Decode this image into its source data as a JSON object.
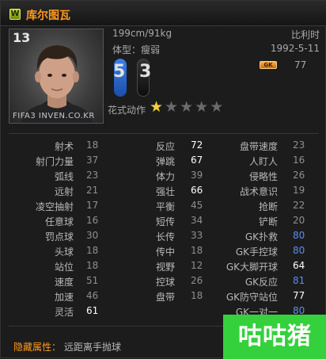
{
  "header": {
    "badge": "W",
    "name": "库尔图瓦"
  },
  "portrait": {
    "rating": "13",
    "watermark": "FIFA3 INVEN.CO.KR"
  },
  "info": {
    "height_weight": "199cm/91kg",
    "nationality": "比利时",
    "body_type": "体型：瘦弱",
    "birth_date": "1992-5-11",
    "left_foot": "5",
    "right_foot": "3",
    "position_tag": "GK",
    "position_rating": "77",
    "skill_moves_label": "花式动作",
    "skill_moves_stars": 1,
    "skill_moves_max": 5
  },
  "colors": {
    "accent": "#ff9a1e",
    "value_blue": "#5b8ef0",
    "logo_green": "#35d13c"
  },
  "stats": {
    "col1": [
      {
        "label": "射术",
        "value": "18",
        "style": "normal"
      },
      {
        "label": "射门力量",
        "value": "37",
        "style": "normal"
      },
      {
        "label": "弧线",
        "value": "23",
        "style": "normal"
      },
      {
        "label": "远射",
        "value": "21",
        "style": "normal"
      },
      {
        "label": "凌空抽射",
        "value": "17",
        "style": "normal"
      },
      {
        "label": "任意球",
        "value": "16",
        "style": "normal"
      },
      {
        "label": "罚点球",
        "value": "30",
        "style": "normal"
      },
      {
        "label": "头球",
        "value": "18",
        "style": "normal"
      },
      {
        "label": "站位",
        "value": "18",
        "style": "normal"
      },
      {
        "label": "速度",
        "value": "51",
        "style": "normal"
      },
      {
        "label": "加速",
        "value": "46",
        "style": "normal"
      },
      {
        "label": "灵活",
        "value": "61",
        "style": "bright"
      }
    ],
    "col2": [
      {
        "label": "反应",
        "value": "72",
        "style": "bright"
      },
      {
        "label": "弹跳",
        "value": "67",
        "style": "bright"
      },
      {
        "label": "体力",
        "value": "39",
        "style": "normal"
      },
      {
        "label": "强壮",
        "value": "66",
        "style": "bright"
      },
      {
        "label": "平衡",
        "value": "45",
        "style": "normal"
      },
      {
        "label": "短传",
        "value": "34",
        "style": "normal"
      },
      {
        "label": "长传",
        "value": "33",
        "style": "normal"
      },
      {
        "label": "传中",
        "value": "18",
        "style": "normal"
      },
      {
        "label": "视野",
        "value": "12",
        "style": "normal"
      },
      {
        "label": "控球",
        "value": "26",
        "style": "normal"
      },
      {
        "label": "盘带",
        "value": "18",
        "style": "normal"
      }
    ],
    "col3": [
      {
        "label": "盘带速度",
        "value": "23",
        "style": "normal"
      },
      {
        "label": "人盯人",
        "value": "16",
        "style": "normal"
      },
      {
        "label": "侵略性",
        "value": "26",
        "style": "normal"
      },
      {
        "label": "战术意识",
        "value": "19",
        "style": "normal"
      },
      {
        "label": "抢断",
        "value": "22",
        "style": "normal"
      },
      {
        "label": "铲断",
        "value": "20",
        "style": "normal"
      },
      {
        "label": "GK扑救",
        "value": "80",
        "style": "blue"
      },
      {
        "label": "GK手控球",
        "value": "80",
        "style": "blue"
      },
      {
        "label": "GK大脚开球",
        "value": "64",
        "style": "bright"
      },
      {
        "label": "GK反应",
        "value": "81",
        "style": "blue"
      },
      {
        "label": "GK防守站位",
        "value": "77",
        "style": "bright"
      },
      {
        "label": "GK一对一",
        "value": "80",
        "style": "blue"
      }
    ]
  },
  "hidden": {
    "label": "隐藏属性：",
    "value": "远距离手抛球"
  },
  "logo": {
    "text": "咕咕猪"
  }
}
